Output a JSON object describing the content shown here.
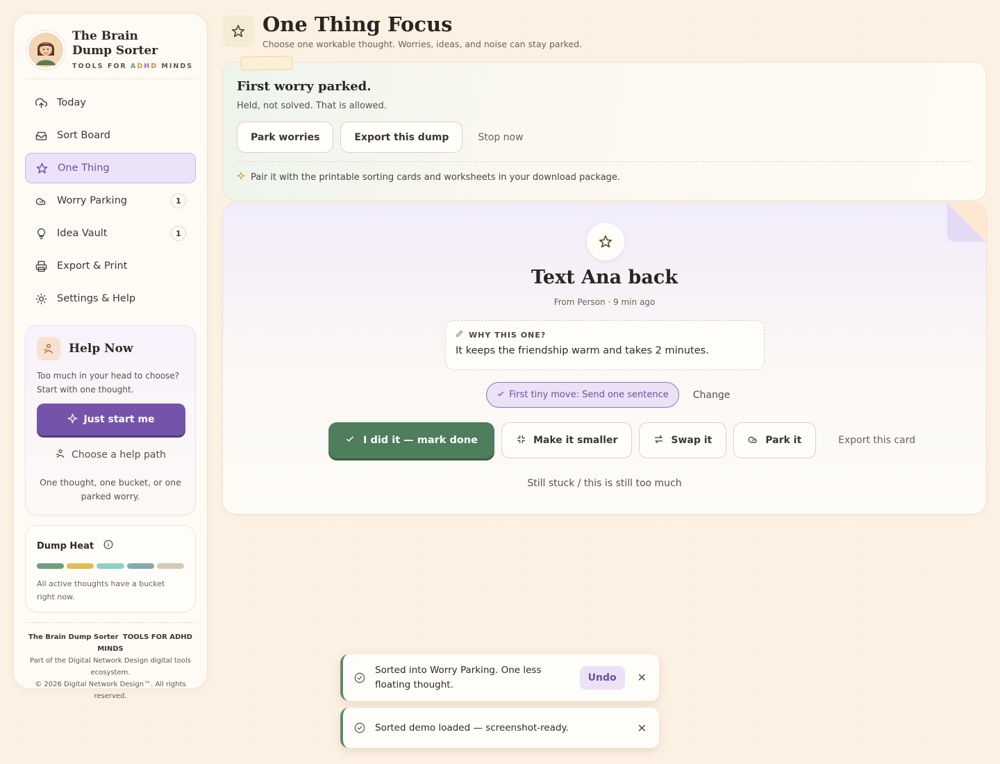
{
  "brand": {
    "name_line1": "The Brain",
    "name_line2": "Dump Sorter",
    "tag_pre": "TOOLS FOR ",
    "tag_a": "A",
    "tag_d": "D",
    "tag_h": "H",
    "tag_d2": "D",
    "tag_post": " MINDS"
  },
  "nav": [
    {
      "label": "Today",
      "icon": "cloud-upload-icon"
    },
    {
      "label": "Sort Board",
      "icon": "inbox-icon"
    },
    {
      "label": "One Thing",
      "icon": "star-icon",
      "active": true
    },
    {
      "label": "Worry Parking",
      "icon": "cloud-icon",
      "badge": "1"
    },
    {
      "label": "Idea Vault",
      "icon": "lightbulb-icon",
      "badge": "1"
    },
    {
      "label": "Export & Print",
      "icon": "printer-icon"
    },
    {
      "label": "Settings & Help",
      "icon": "sun-gear-icon"
    }
  ],
  "help": {
    "title": "Help Now",
    "body": "Too much in your head to choose? Start with one thought.",
    "primary": "Just start me",
    "link": "Choose a help path",
    "foot": "One thought, one bucket, or one parked worry."
  },
  "heat": {
    "title": "Dump Heat",
    "colors": [
      "#6f9e7c",
      "#e2bd55",
      "#8fd0c4",
      "#86a9ab",
      "#d6c9b6"
    ],
    "text": "All active thoughts have a bucket right now."
  },
  "footer": {
    "brand": "The Brain Dump Sorter",
    "tag": "TOOLS FOR ADHD MINDS",
    "line1": "Part of the Digital Network Design digital tools ecosystem.",
    "line2": "© 2026 Digital Network Design™. All rights reserved."
  },
  "header": {
    "title": "One Thing Focus",
    "subtitle": "Choose one workable thought. Worries, ideas, and noise can stay parked."
  },
  "parked": {
    "title": "First worry parked.",
    "subtitle": "Held, not solved. That is allowed.",
    "btn1": "Park worries",
    "btn2": "Export this dump",
    "btn3": "Stop now",
    "tip": "Pair it with the printable sorting cards and worksheets in your download package."
  },
  "focus": {
    "title": "Text Ana back",
    "meta": "From Person · 9 min ago",
    "why_label": "WHY THIS ONE?",
    "why_text": "It keeps the friendship warm and takes 2 minutes.",
    "move": "First tiny move: Send one sentence",
    "change": "Change",
    "done": "I did it — mark done",
    "smaller": "Make it smaller",
    "swap": "Swap it",
    "park": "Park it",
    "export": "Export this card",
    "stuck": "Still stuck / this is still too much"
  },
  "toasts": [
    {
      "text": "Sorted into Worry Parking. One less floating thought.",
      "action": "Undo"
    },
    {
      "text": "Sorted demo loaded — screenshot-ready."
    }
  ],
  "colors": {
    "accent": "#7454aa",
    "success": "#4e7e5c",
    "bg": "#fdf1e4"
  }
}
